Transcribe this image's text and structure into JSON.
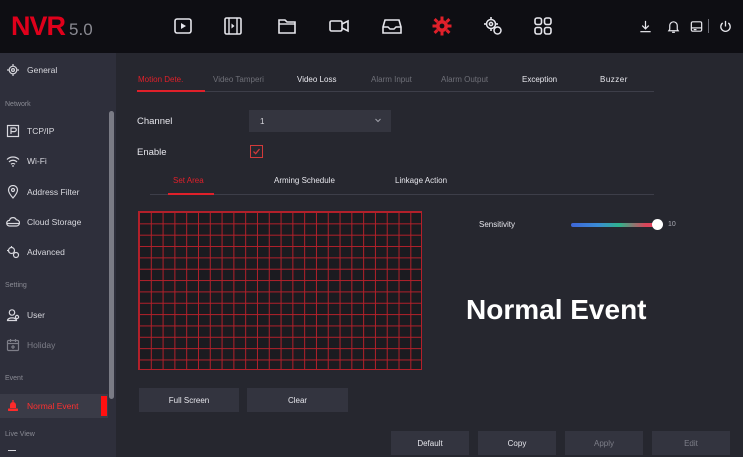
{
  "logo": {
    "main": "NVR",
    "version": "5.0"
  },
  "colors": {
    "accent": "#e0202a",
    "logo_red": "#e0001b",
    "topbar": "#0e0e13",
    "sidebar": "#2e2f3b"
  },
  "top_icons": [
    "play-icon",
    "film-icon",
    "folder-icon",
    "camera-icon",
    "inbox-icon",
    "settings-active-icon",
    "system-gear-icon",
    "grid-icon"
  ],
  "right_icons": [
    "download-icon",
    "bell-icon",
    "disk-icon",
    "power-icon"
  ],
  "sidebar": {
    "items": {
      "general": "General",
      "tcpip": "TCP/IP",
      "wifi": "Wi-Fi",
      "address_filter": "Address Filter",
      "cloud_storage": "Cloud Storage",
      "advanced": "Advanced",
      "user": "User",
      "holiday": "Holiday",
      "normal_event": "Normal Event"
    },
    "categories": {
      "network": "Network",
      "setting": "Setting",
      "event": "Event",
      "live_view": "Live View"
    }
  },
  "tabs": {
    "motion_detection": "Motion Dete.",
    "video_tamper": "Video Tamperi",
    "video_loss": "Video Loss",
    "alarm_input": "Alarm Input",
    "alarm_output": "Alarm Output",
    "exception": "Exception",
    "buzzer": "Buzzer"
  },
  "form": {
    "channel_label": "Channel",
    "channel_value": "1",
    "enable_label": "Enable",
    "enable_checked": true
  },
  "subtabs": {
    "set_area": "Set Area",
    "arming_schedule": "Arming Schedule",
    "linkage_action": "Linkage Action"
  },
  "sensitivity": {
    "label": "Sensitivity",
    "value": "10"
  },
  "overlay_title": "Normal Event",
  "buttons": {
    "full_screen": "Full Screen",
    "clear": "Clear",
    "default": "Default",
    "copy": "Copy",
    "apply": "Apply",
    "edit": "Edit"
  }
}
